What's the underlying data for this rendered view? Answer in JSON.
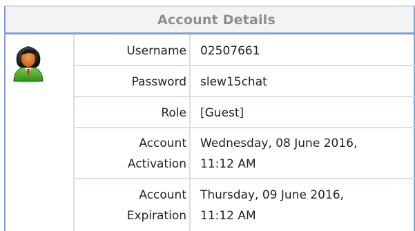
{
  "panel": {
    "title": "Account Details",
    "icon": "user-avatar-icon",
    "colors": {
      "border": "#7f9fd0",
      "divider": "#d4e0f1",
      "title_text": "#8d8d8d",
      "title_bg": "#f3f3f3"
    }
  },
  "fields": {
    "username": {
      "label": "Username",
      "value": "02507661"
    },
    "password": {
      "label": "Password",
      "value": "slew15chat"
    },
    "role": {
      "label": "Role",
      "value": "[Guest]"
    },
    "activation": {
      "label_line1": "Account",
      "label_line2": "Activation",
      "value_line1": "Wednesday, 08 June 2016,",
      "value_line2": "11:12 AM"
    },
    "expiration": {
      "label_line1": "Account",
      "label_line2": "Expiration",
      "value_line1": "Thursday, 09 June 2016,",
      "value_line2": "11:12 AM"
    }
  }
}
